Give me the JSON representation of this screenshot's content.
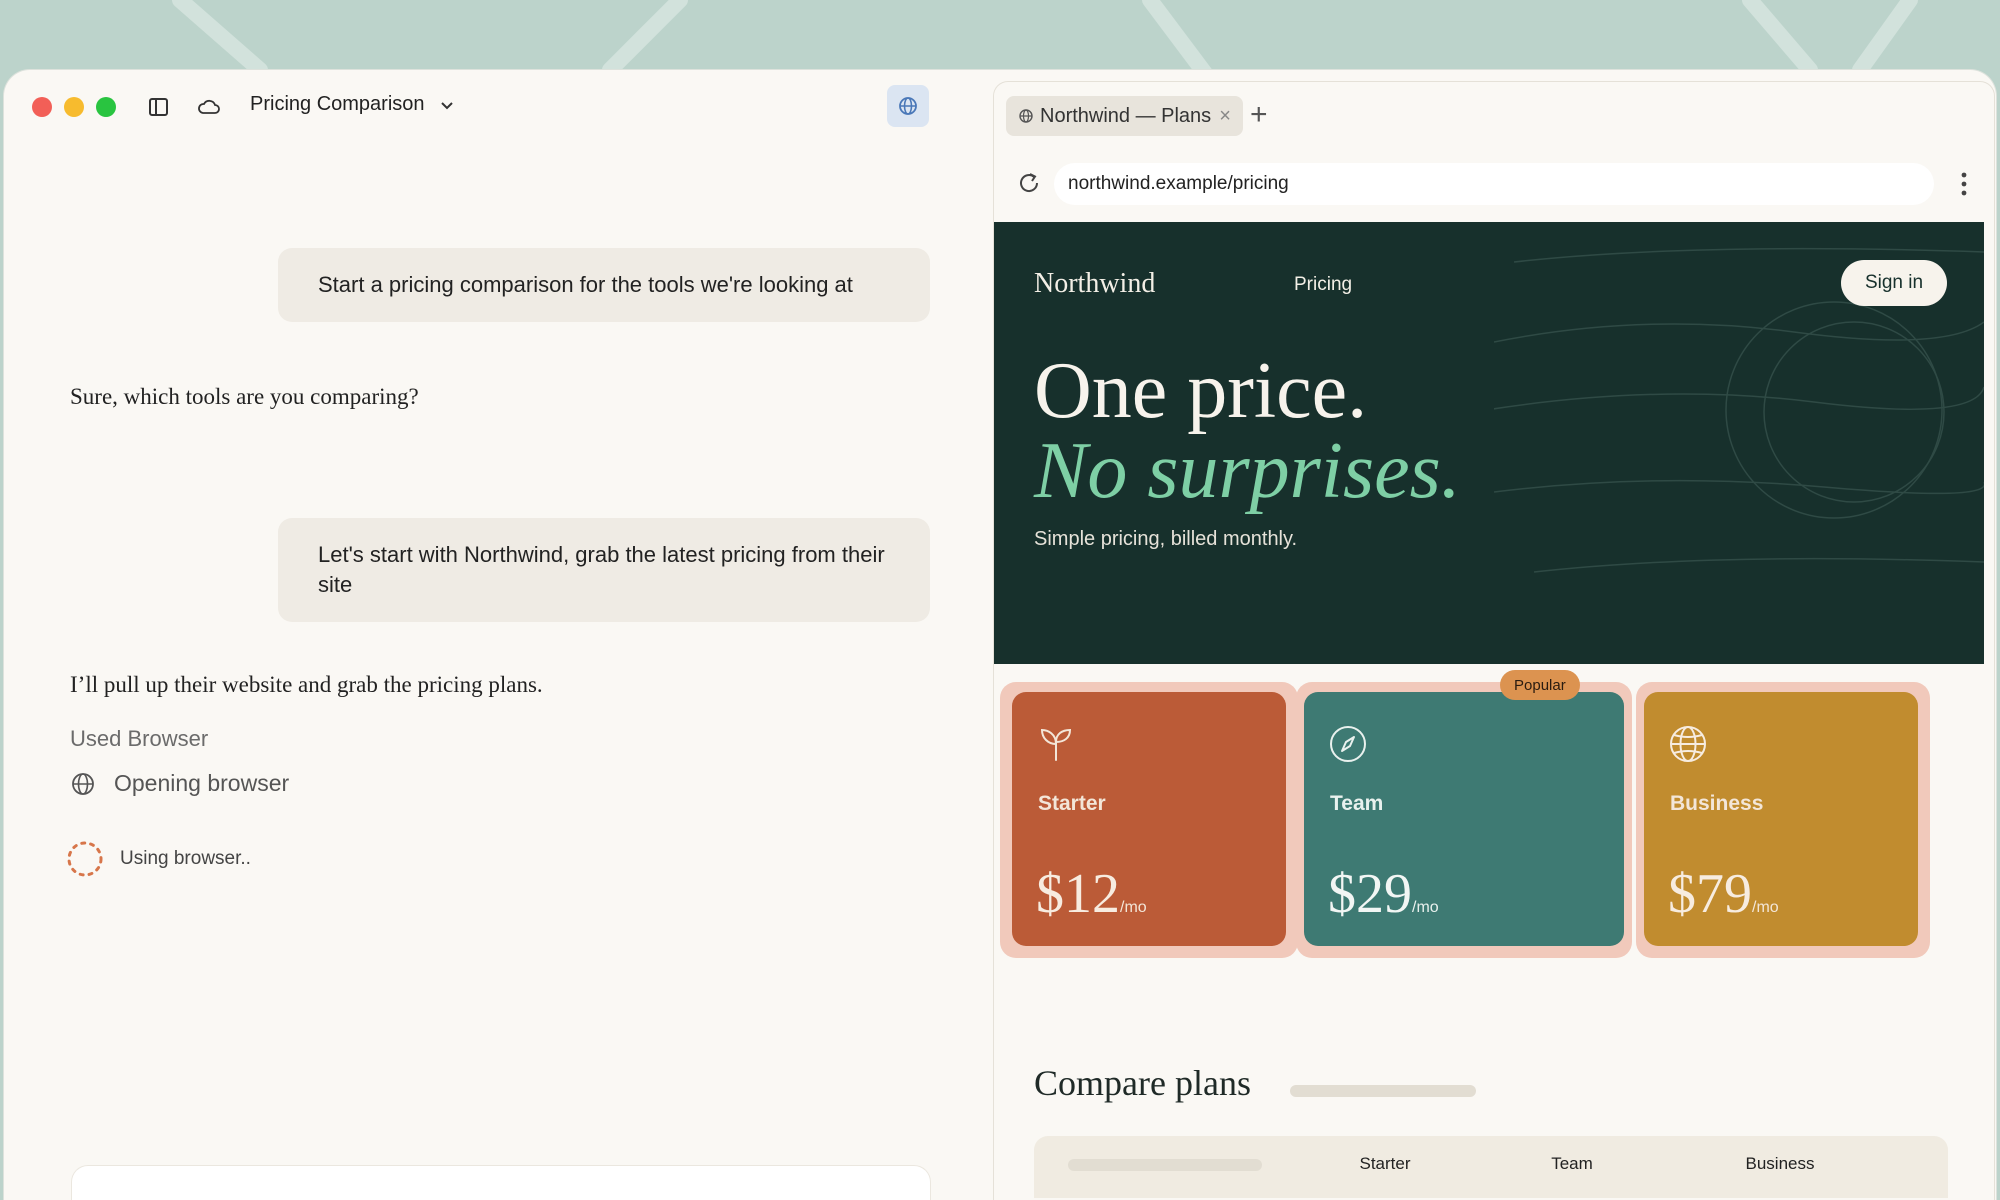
{
  "app": {
    "conversation_title": "Pricing Comparison"
  },
  "chat": {
    "user_msg_1": "Start a pricing comparison for the tools we're looking at",
    "assistant_msg_1": "Sure, which tools are you comparing?",
    "user_msg_2": "Let's start with Northwind, grab the latest pricing from their site",
    "assistant_msg_2": "I’ll pull up their website and grab the pricing plans.",
    "used_label": "Used Browser",
    "tool_step": "Opening browser",
    "status": "Using browser.."
  },
  "browser": {
    "tab_title": "Northwind — Plans",
    "url": "northwind.example/pricing"
  },
  "site": {
    "logo": "Northwind",
    "nav_pricing": "Pricing",
    "signin": "Sign in",
    "headline_1": "One price.",
    "headline_2": "No surprises.",
    "subtitle": "Simple pricing, billed monthly.",
    "badge": "Popular",
    "plans": [
      {
        "name": "Starter",
        "price": "$12",
        "unit": "/mo",
        "color": "#bb5b37",
        "icon": "sprout-icon"
      },
      {
        "name": "Team",
        "price": "$29",
        "unit": "/mo",
        "color": "#3e7a73",
        "icon": "compass-icon"
      },
      {
        "name": "Business",
        "price": "$79",
        "unit": "/mo",
        "color": "#c18c2f",
        "icon": "globe-icon"
      }
    ],
    "compare_title": "Compare plans",
    "table_headers": [
      "Starter",
      "Team",
      "Business"
    ]
  }
}
